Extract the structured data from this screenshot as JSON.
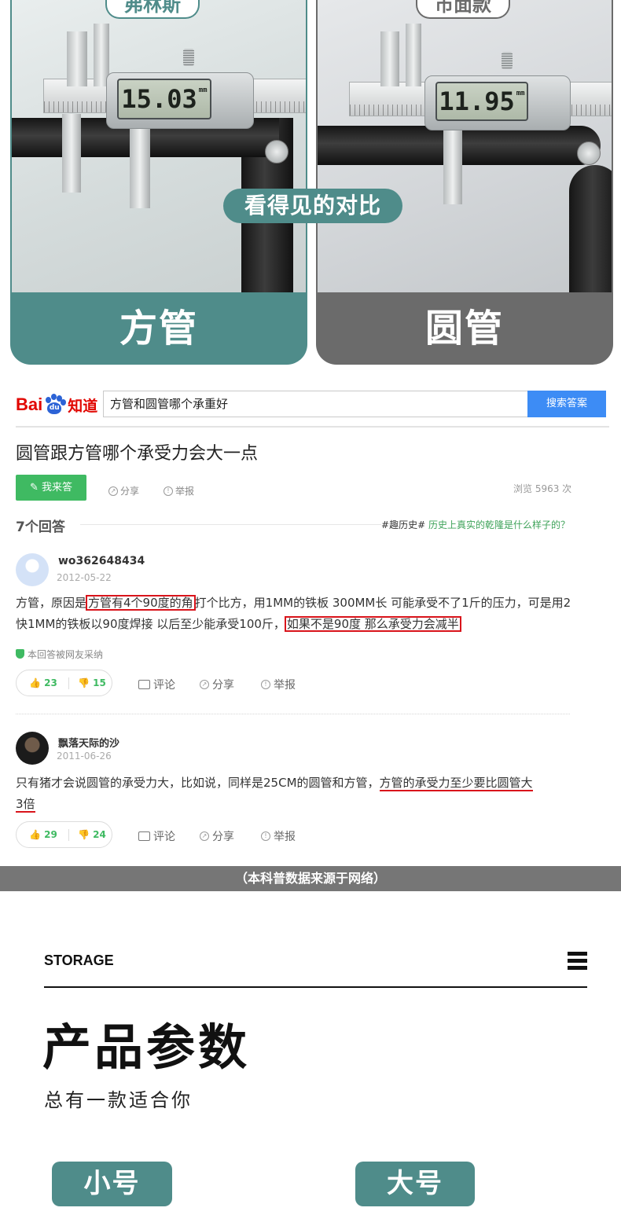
{
  "comparison": {
    "center_pill": "看得见的对比",
    "left": {
      "brand": "弗林斯",
      "reading": "15.03",
      "unit": "mm",
      "label": "方管"
    },
    "right": {
      "brand": "市面款",
      "reading": "11.95",
      "unit": "mm",
      "label": "圆管"
    }
  },
  "zhidao": {
    "logo": {
      "bai": "Bai",
      "du": "du",
      "zhidao": "知道"
    },
    "search_value": "方管和圆管哪个承重好",
    "search_button": "搜索答案",
    "question_title": "圆管跟方管哪个承受力会大一点",
    "answer_button": "我来答",
    "share": "分享",
    "report": "举报",
    "views": "浏览 5963 次",
    "answer_count": "7个回答",
    "topic_tag": "#趣历史#",
    "topic_link": "历史上真实的乾隆是什么样子的？",
    "answers": [
      {
        "username": "wo362648434",
        "date": "2012-05-22",
        "text_1": "方管，原因是",
        "highlight_1": "方管有4个90度的角",
        "text_2": "打个比方，用1MM的铁板 300MM长 可能承受不了1斤的压力，可是用2快1MM的铁板以90度焊接 以后至少能承受100斤，",
        "highlight_2": "如果不是90度 那么承受力会减半",
        "adopted": "本回答被网友采纳",
        "likes": "23",
        "dislikes": "15",
        "comment": "评论",
        "share": "分享",
        "report": "举报"
      },
      {
        "username": "飘落天际的沙",
        "date": "2011-06-26",
        "text_1": "只有猪才会说圆管的承受力大，比如说，同样是25CM的圆管和方管，",
        "highlight_1": "方管的承受力至少要比圆管大",
        "highlight_2": "3倍",
        "likes": "29",
        "dislikes": "24",
        "comment": "评论",
        "share": "分享",
        "report": "举报"
      }
    ]
  },
  "source_note": "（本科普数据来源于网络）",
  "params": {
    "storage": "STORAGE",
    "title": "产品参数",
    "subtitle": "总有一款适合你",
    "small": "小号",
    "large": "大号"
  },
  "colors": {
    "teal": "#4f8c8a",
    "gray": "#6b6b6b",
    "baidu_red": "#e10601",
    "baidu_blue": "#3d8cf5",
    "green": "#3fba62",
    "highlight_red": "#d9141b"
  }
}
